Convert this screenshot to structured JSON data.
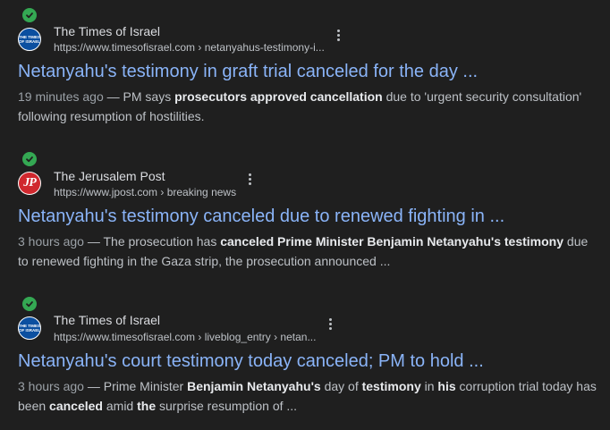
{
  "results": [
    {
      "source": "The Times of Israel",
      "favicon_text": "THE TIMES OF ISRAEL",
      "url": "https://www.timesofisrael.com › netanyahus-testimony-i...",
      "title": "Netanyahu's testimony in graft trial canceled for the day ...",
      "snippet": {
        "date": "19 minutes ago",
        "sep": " — ",
        "parts": [
          {
            "t": "PM says ",
            "b": false
          },
          {
            "t": "prosecutors approved cancellation",
            "b": true
          },
          {
            "t": " due to 'urgent security consultation' following resumption of hostilities.",
            "b": false
          }
        ]
      }
    },
    {
      "source": "The Jerusalem Post",
      "favicon_text": "JP",
      "url": "https://www.jpost.com › breaking news",
      "title": "Netanyahu's testimony canceled due to renewed fighting in ...",
      "snippet": {
        "date": "3 hours ago",
        "sep": " — ",
        "parts": [
          {
            "t": "The prosecution has ",
            "b": false
          },
          {
            "t": "canceled Prime Minister Benjamin Netanyahu's testimony",
            "b": true
          },
          {
            "t": " due to renewed fighting in the Gaza strip, the prosecution announced ...",
            "b": false
          }
        ]
      }
    },
    {
      "source": "The Times of Israel",
      "favicon_text": "THE TIMES OF ISRAEL",
      "url": "https://www.timesofisrael.com › liveblog_entry › netan...",
      "title": "Netanyahu's court testimony today canceled; PM to hold ...",
      "snippet": {
        "date": "3 hours ago",
        "sep": " — ",
        "parts": [
          {
            "t": "Prime Minister ",
            "b": false
          },
          {
            "t": "Benjamin Netanyahu's",
            "b": true
          },
          {
            "t": " day of ",
            "b": false
          },
          {
            "t": "testimony",
            "b": true
          },
          {
            "t": " in ",
            "b": false
          },
          {
            "t": "his",
            "b": true
          },
          {
            "t": " corruption trial today has been ",
            "b": false
          },
          {
            "t": "canceled",
            "b": true
          },
          {
            "t": " amid ",
            "b": false
          },
          {
            "t": "the",
            "b": true
          },
          {
            "t": " surprise resumption of ...",
            "b": false
          }
        ]
      }
    }
  ],
  "colors": {
    "background": "#1f1f1f",
    "title_link": "#8ab4f8",
    "verified_check": "#34a853",
    "toi_favicon": "#0b4fa0",
    "jp_favicon": "#d0282e"
  },
  "icons": {
    "verified": "check-circle-icon",
    "more": "more-vert-icon"
  }
}
